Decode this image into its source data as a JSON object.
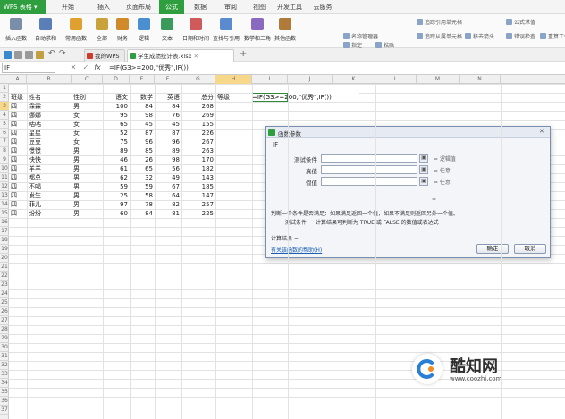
{
  "app": {
    "name": "WPS 表格",
    "dropdown_icon": "chevron-down-icon"
  },
  "menu": [
    "开始",
    "插入",
    "页面布局",
    "公式",
    "数据",
    "审阅",
    "视图",
    "开发工具",
    "云服务"
  ],
  "active_menu": "公式",
  "ribbon": {
    "big_buttons": [
      {
        "label": "插入函数",
        "icon": "fx-icon",
        "color": "#7b8ea8"
      },
      {
        "label": "自动求和",
        "icon": "sigma-icon",
        "color": "#5a7fb8"
      },
      {
        "label": "常用函数",
        "icon": "star-function-icon",
        "color": "#e0a030"
      },
      {
        "label": "全部",
        "icon": "all-functions-icon",
        "color": "#c9a23a"
      },
      {
        "label": "财务",
        "icon": "finance-icon",
        "color": "#d08a2a"
      },
      {
        "label": "逻辑",
        "icon": "logic-icon",
        "color": "#4a8fd0"
      },
      {
        "label": "文本",
        "icon": "text-icon",
        "color": "#3a9a5a"
      },
      {
        "label": "日期和时间",
        "icon": "date-time-icon",
        "color": "#d05a5a"
      },
      {
        "label": "查找与引用",
        "icon": "lookup-icon",
        "color": "#5a8ad0"
      },
      {
        "label": "数学和三角",
        "icon": "math-icon",
        "color": "#8a6ac0"
      },
      {
        "label": "其他函数",
        "icon": "other-functions-icon",
        "color": "#b07a3a"
      }
    ],
    "small_buttons": [
      {
        "label": "名称管理器",
        "icon": "name-manager-icon"
      },
      {
        "label": "指定",
        "icon": "define-icon"
      },
      {
        "label": "粘贴",
        "icon": "paste-icon"
      },
      {
        "label": "追踪引用单元格",
        "icon": "trace-precedents-icon"
      },
      {
        "label": "追踪从属单元格",
        "icon": "trace-dependents-icon"
      },
      {
        "label": "移去箭头",
        "icon": "remove-arrows-icon"
      },
      {
        "label": "公式求值",
        "icon": "evaluate-icon"
      },
      {
        "label": "错误检查",
        "icon": "error-check-icon"
      },
      {
        "label": "重算工作簿",
        "icon": "recalc-icon"
      }
    ]
  },
  "tabs": [
    {
      "label": "我的WPS",
      "icon": "wps-icon",
      "color": "#d03a2a"
    },
    {
      "label": "学生成绩统计表.xlsx",
      "icon": "sheet-icon",
      "color": "#2e9e3e"
    }
  ],
  "formula_bar": {
    "name_box": "IF",
    "cancel": "✕",
    "confirm": "✓",
    "fx": "fx",
    "formula": "=IF(G3>=200,\"优秀\",IF())"
  },
  "columns": [
    "A",
    "B",
    "C",
    "D",
    "E",
    "F",
    "G",
    "H",
    "I",
    "J",
    "K",
    "L",
    "M",
    "N"
  ],
  "selected_column": "H",
  "rows": [
    "1",
    "2",
    "3",
    "4",
    "5",
    "6",
    "7",
    "8",
    "9",
    "10",
    "11",
    "12",
    "13",
    "14",
    "15",
    "16",
    "17",
    "18",
    "19",
    "20",
    "21",
    "22",
    "23",
    "24",
    "25",
    "26",
    "27",
    "28",
    "29",
    "30",
    "31",
    "32",
    "33",
    "34",
    "35",
    "36",
    "37"
  ],
  "selected_row": "3",
  "sheet": {
    "headers": [
      "班级",
      "姓名",
      "性别",
      "语文",
      "数学",
      "英语",
      "总分",
      "等级"
    ],
    "data": [
      [
        "四",
        "霖霖",
        "男",
        "100",
        "84",
        "84",
        "268"
      ],
      [
        "四",
        "娜娜",
        "女",
        "95",
        "98",
        "76",
        "269"
      ],
      [
        "四",
        "咕咕",
        "女",
        "65",
        "45",
        "45",
        "155"
      ],
      [
        "四",
        "星星",
        "女",
        "52",
        "87",
        "87",
        "226"
      ],
      [
        "四",
        "豆豆",
        "女",
        "75",
        "96",
        "96",
        "267"
      ],
      [
        "四",
        "憬憬",
        "男",
        "89",
        "85",
        "89",
        "263"
      ],
      [
        "四",
        "快快",
        "男",
        "46",
        "26",
        "98",
        "170"
      ],
      [
        "四",
        "羊羊",
        "男",
        "61",
        "65",
        "56",
        "182"
      ],
      [
        "四",
        "都总",
        "男",
        "62",
        "32",
        "49",
        "143"
      ],
      [
        "四",
        "不喝",
        "男",
        "59",
        "59",
        "67",
        "185"
      ],
      [
        "四",
        "发生",
        "男",
        "25",
        "58",
        "64",
        "147"
      ],
      [
        "四",
        "菲儿",
        "男",
        "97",
        "78",
        "82",
        "257"
      ],
      [
        "四",
        "纷纷",
        "男",
        "60",
        "84",
        "81",
        "225"
      ]
    ],
    "editing_cell": "=IF(G3>=200,\"优秀\",IF())"
  },
  "dialog": {
    "title": "函数参数",
    "function_name": "IF",
    "args": [
      {
        "label": "测试条件",
        "result": "= 逻辑值"
      },
      {
        "label": "真值",
        "result": "= 任意"
      },
      {
        "label": "假值",
        "result": "= 任意"
      }
    ],
    "description": "判断一个条件是否满足：如果满足返回一个值，如果不满足则返回另外一个值。",
    "arg_help_label": "测试条件",
    "arg_help_text": "计算结果可判断为 TRUE 或 FALSE 的数值或表达式",
    "result_label": "计算结果 =",
    "help_link": "有关该函数的帮助(H)",
    "ok": "确定",
    "cancel": "取消",
    "close": "✕"
  },
  "watermark": {
    "brand": "酷知网",
    "url": "www.coozhi.com"
  }
}
